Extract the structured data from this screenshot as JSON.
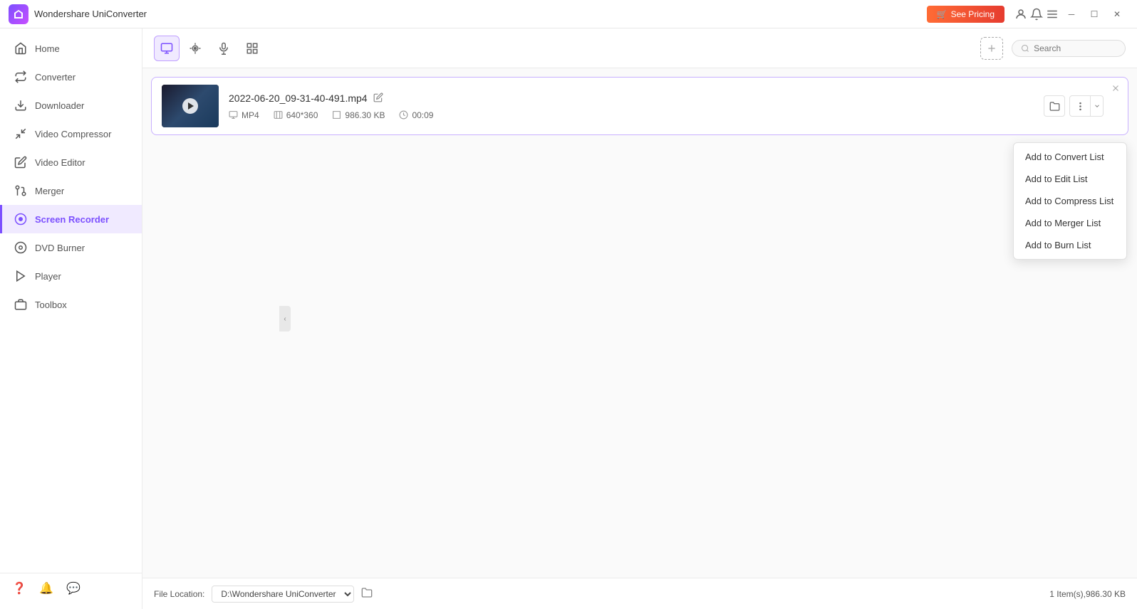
{
  "app": {
    "title": "Wondershare UniConverter",
    "logo_color": "#7b4fff"
  },
  "titlebar": {
    "see_pricing": "See Pricing",
    "cart_icon": "🛒"
  },
  "sidebar": {
    "items": [
      {
        "id": "home",
        "label": "Home",
        "icon": "home"
      },
      {
        "id": "converter",
        "label": "Converter",
        "icon": "converter"
      },
      {
        "id": "downloader",
        "label": "Downloader",
        "icon": "downloader"
      },
      {
        "id": "video-compressor",
        "label": "Video Compressor",
        "icon": "compress"
      },
      {
        "id": "video-editor",
        "label": "Video Editor",
        "icon": "editor"
      },
      {
        "id": "merger",
        "label": "Merger",
        "icon": "merger"
      },
      {
        "id": "screen-recorder",
        "label": "Screen Recorder",
        "icon": "recorder",
        "active": true
      },
      {
        "id": "dvd-burner",
        "label": "DVD Burner",
        "icon": "dvd"
      },
      {
        "id": "player",
        "label": "Player",
        "icon": "player"
      },
      {
        "id": "toolbox",
        "label": "Toolbox",
        "icon": "toolbox"
      }
    ],
    "footer": {
      "help_icon": "❓",
      "bell_icon": "🔔",
      "feedback_icon": "💬"
    }
  },
  "toolbar": {
    "buttons": [
      {
        "id": "record",
        "icon": "⬛",
        "active": true
      },
      {
        "id": "webcam",
        "icon": "⊙"
      },
      {
        "id": "mic",
        "icon": "🎙"
      },
      {
        "id": "grid",
        "icon": "⊞"
      }
    ]
  },
  "search": {
    "placeholder": "Search"
  },
  "file": {
    "name": "2022-06-20_09-31-40-491.mp4",
    "format": "MP4",
    "resolution": "640*360",
    "size": "986.30 KB",
    "duration": "00:09"
  },
  "dropdown_menu": {
    "items": [
      {
        "id": "convert",
        "label": "Add to Convert List"
      },
      {
        "id": "edit",
        "label": "Add to Edit List"
      },
      {
        "id": "compress",
        "label": "Add to Compress List"
      },
      {
        "id": "merge",
        "label": "Add to Merger List"
      },
      {
        "id": "burn",
        "label": "Add to Burn List"
      }
    ]
  },
  "footer": {
    "file_location_label": "File Location:",
    "location_value": "D:\\Wondershare UniConverter",
    "status": "1 Item(s),986.30 KB"
  }
}
